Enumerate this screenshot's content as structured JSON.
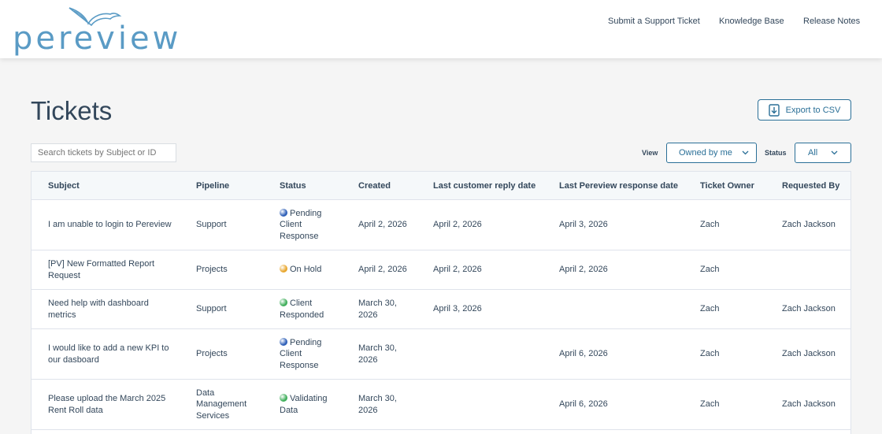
{
  "brand": {
    "logo_text": "pereview"
  },
  "nav": {
    "submit_ticket": "Submit a Support Ticket",
    "knowledge_base": "Knowledge Base",
    "release_notes": "Release Notes"
  },
  "page": {
    "title": "Tickets",
    "export_label": "Export to CSV"
  },
  "search": {
    "placeholder": "Search tickets by Subject or ID"
  },
  "filters": {
    "view_label": "View",
    "view_value": "Owned by me",
    "status_label": "Status",
    "status_value": "All"
  },
  "table": {
    "headers": [
      "Subject",
      "Pipeline",
      "Status",
      "Created",
      "Last customer reply date",
      "Last Pereview response date",
      "Ticket Owner",
      "Requested By"
    ],
    "rows": [
      {
        "subject": "I am unable to login to Pereview",
        "pipeline": "Support",
        "status": "Pending Client Response",
        "status_color": "#2e5fb8",
        "created": "April 2, 2026",
        "last_customer_reply": "April 2, 2026",
        "last_pereview_response": "April 3, 2026",
        "owner": "Zach",
        "requested_by": "Zach Jackson"
      },
      {
        "subject": "[PV] New Formatted Report Request",
        "pipeline": "Projects",
        "status": "On Hold",
        "status_color": "#e8a62c",
        "created": "April 2, 2026",
        "last_customer_reply": "April 2, 2026",
        "last_pereview_response": "April 2, 2026",
        "owner": "Zach",
        "requested_by": ""
      },
      {
        "subject": "Need help with dashboard metrics",
        "pipeline": "Support",
        "status": "Client Responded",
        "status_color": "#3fae5a",
        "created": "March 30, 2026",
        "last_customer_reply": "April 3, 2026",
        "last_pereview_response": "",
        "owner": "Zach",
        "requested_by": "Zach Jackson"
      },
      {
        "subject": "I would like to add a new KPI to our dasboard",
        "pipeline": "Projects",
        "status": "Pending Client Response",
        "status_color": "#2e5fb8",
        "created": "March 30, 2026",
        "last_customer_reply": "",
        "last_pereview_response": "April 6, 2026",
        "owner": "Zach",
        "requested_by": "Zach Jackson"
      },
      {
        "subject": "Please upload the March 2025 Rent Roll data",
        "pipeline": "Data Management Services",
        "status": "Validating Data",
        "status_color": "#3fae5a",
        "created": "March 30, 2026",
        "last_customer_reply": "",
        "last_pereview_response": "April 6, 2026",
        "owner": "Zach",
        "requested_by": "Zach Jackson"
      }
    ]
  }
}
